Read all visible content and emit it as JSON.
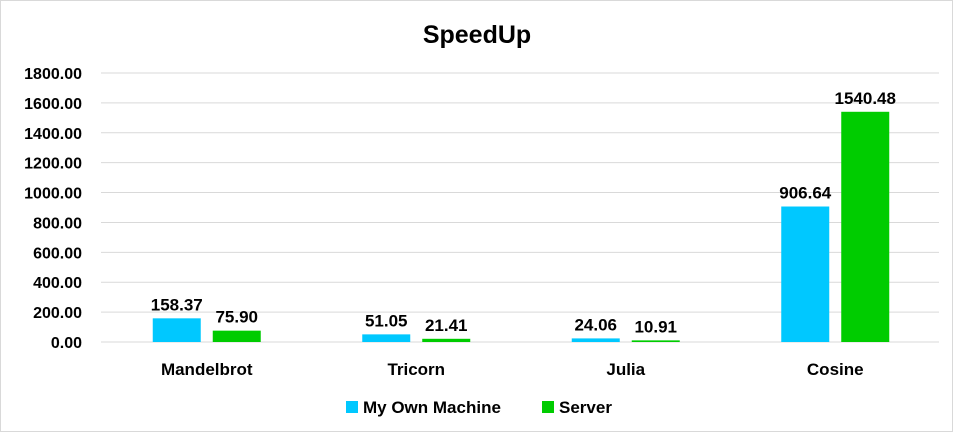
{
  "chart_data": {
    "type": "bar",
    "title": "SpeedUp",
    "xlabel": "",
    "ylabel": "",
    "categories": [
      "Mandelbrot",
      "Tricorn",
      "Julia",
      "Cosine"
    ],
    "series": [
      {
        "name": "My Own Machine",
        "color": "#00c8ff",
        "values": [
          158.37,
          51.05,
          24.06,
          906.64
        ],
        "labels": [
          "158.37",
          "51.05",
          "24.06",
          "906.64"
        ]
      },
      {
        "name": "Server",
        "color": "#00cc00",
        "values": [
          75.9,
          21.41,
          10.91,
          1540.48
        ],
        "labels": [
          "75.90",
          "21.41",
          "10.91",
          "1540.48"
        ]
      }
    ],
    "ylim": [
      0,
      1800
    ],
    "yticks": [
      0,
      200,
      400,
      600,
      800,
      1000,
      1200,
      1400,
      1600,
      1800
    ],
    "ytick_labels": [
      "0.00",
      "200.00",
      "400.00",
      "600.00",
      "800.00",
      "1000.00",
      "1200.00",
      "1400.00",
      "1600.00",
      "1800.00"
    ],
    "grid": true,
    "legend_position": "bottom"
  }
}
